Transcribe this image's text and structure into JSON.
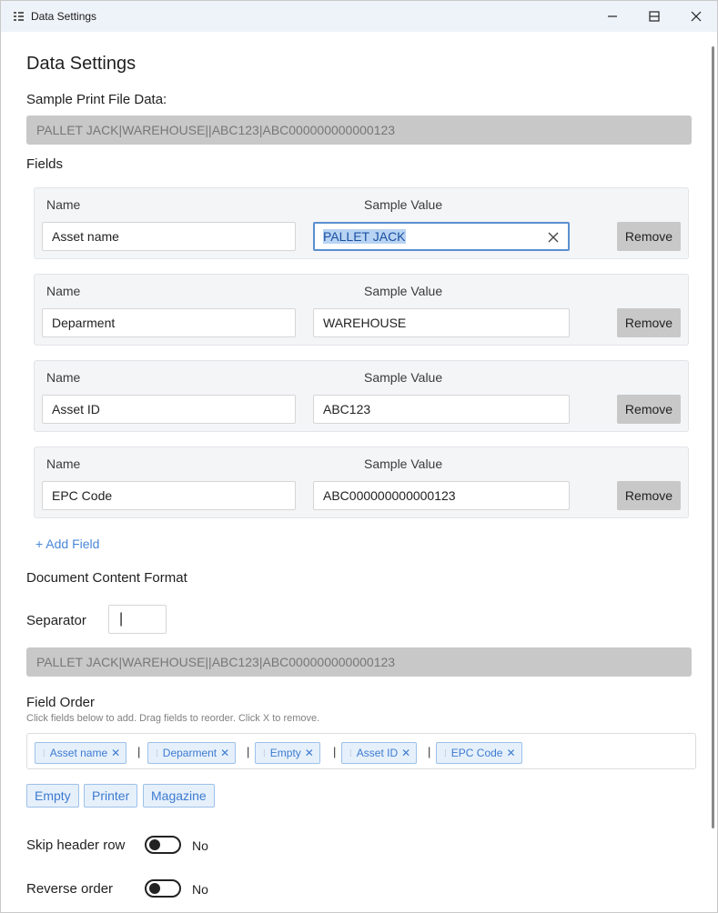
{
  "window": {
    "title": "Data Settings"
  },
  "page": {
    "heading": "Data Settings"
  },
  "sample": {
    "label": "Sample Print File Data:",
    "value": "PALLET JACK|WAREHOUSE||ABC123|ABC000000000000123"
  },
  "fields": {
    "label": "Fields",
    "name_header": "Name",
    "value_header": "Sample Value",
    "remove_label": "Remove",
    "items": [
      {
        "name": "Asset name",
        "value": "PALLET JACK"
      },
      {
        "name": "Deparment",
        "value": "WAREHOUSE"
      },
      {
        "name": "Asset ID",
        "value": "ABC123"
      },
      {
        "name": "EPC Code",
        "value": "ABC000000000000123"
      }
    ],
    "add_label": "+ Add Field"
  },
  "format": {
    "heading": "Document Content Format",
    "separator_label": "Separator",
    "separator_value": "|",
    "preview": "PALLET JACK|WAREHOUSE||ABC123|ABC000000000000123"
  },
  "field_order": {
    "label": "Field Order",
    "hint": "Click fields below to add. Drag fields to reorder. Click X to remove.",
    "chips": [
      "Asset name",
      "Deparment",
      "Empty",
      "Asset ID",
      "EPC Code"
    ],
    "separator": "|",
    "available": [
      "Empty",
      "Printer",
      "Magazine"
    ]
  },
  "options": {
    "skip_header": {
      "label": "Skip header row",
      "value": "No"
    },
    "reverse_order": {
      "label": "Reverse order",
      "value": "No"
    }
  },
  "icons": {
    "app": "app-icon",
    "minimize": "minimize-icon",
    "maximize": "maximize-icon",
    "close": "close-icon",
    "clear": "clear-icon",
    "grip": "drag-handle-icon",
    "remove_chip": "remove-icon"
  },
  "colors": {
    "accent": "#4a88d8",
    "chip_bg": "#e6f0fb",
    "chip_border": "#9dc1ea",
    "readonly_bg": "#c8c8c8",
    "focus_border": "#5b8fcf"
  }
}
